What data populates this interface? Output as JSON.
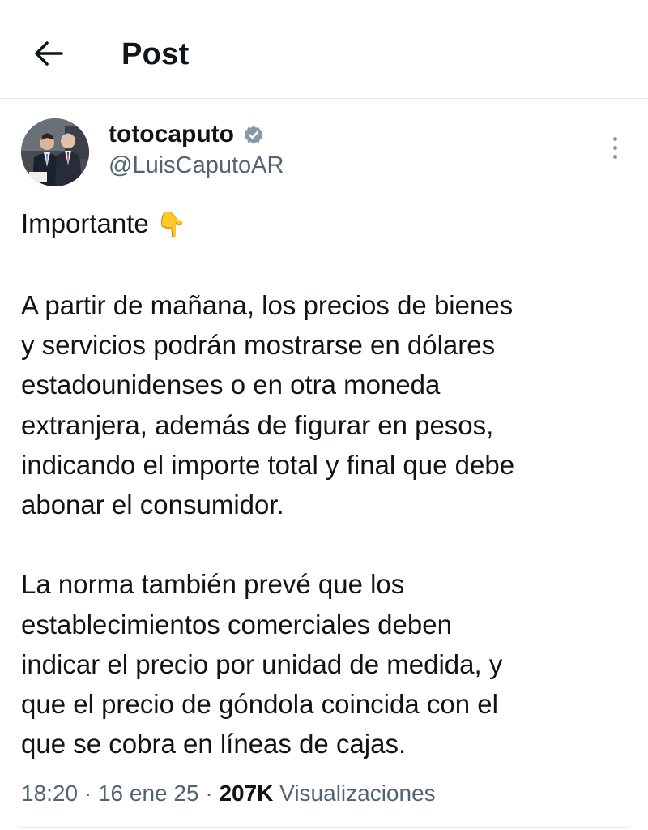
{
  "header": {
    "title": "Post"
  },
  "author": {
    "display_name": "totocaputo",
    "handle": "@LuisCaputoAR",
    "verified": true
  },
  "post": {
    "line1_text": "Importante",
    "line1_emoji": "👇",
    "paragraph2": [
      "A partir de mañana, los precios de bienes",
      "y servicios podrán mostrarse en dólares",
      "estadounidenses o en otra moneda",
      "extranjera, además de figurar en pesos,",
      "indicando el importe total y final que debe",
      "abonar el consumidor."
    ],
    "paragraph3": [
      "La norma también prevé que los",
      "establecimientos comerciales deben",
      "indicar el precio por unidad de medida, y",
      "que el precio de góndola coincida con el",
      "que se cobra en líneas de cajas."
    ]
  },
  "meta": {
    "time": "18:20",
    "date": "16 ene 25",
    "separator": "·",
    "views_count": "207K",
    "views_label": "Visualizaciones"
  },
  "colors": {
    "text": "#0f1419",
    "secondary": "#536471",
    "divider": "#e6e9ec",
    "verified": "#829aab"
  }
}
